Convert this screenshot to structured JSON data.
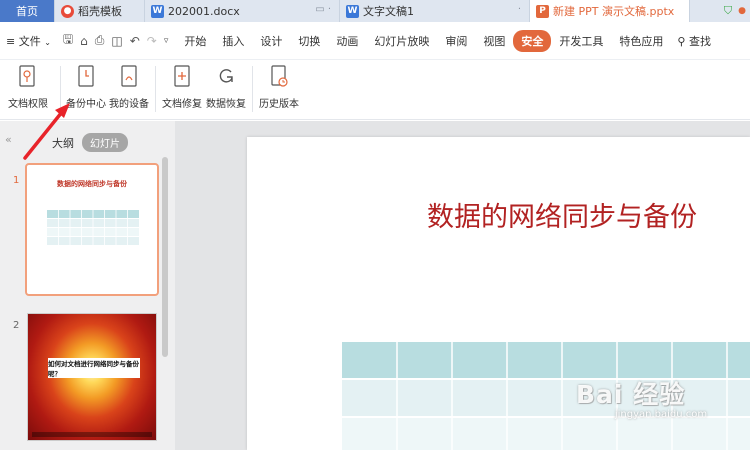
{
  "tabs": [
    {
      "label": "首页",
      "icon": "home-tab"
    },
    {
      "label": "稻壳模板",
      "icon": "docer-icon"
    },
    {
      "label": "202001.docx",
      "icon": "word-doc-icon"
    },
    {
      "label": "文字文稿1",
      "icon": "word-doc-icon"
    },
    {
      "label": "新建 PPT 演示文稿.pptx",
      "icon": "ppt-doc-icon"
    }
  ],
  "menu": {
    "file": "文件",
    "items": [
      "开始",
      "插入",
      "设计",
      "切换",
      "动画",
      "幻灯片放映",
      "审阅",
      "视图",
      "安全",
      "开发工具",
      "特色应用"
    ],
    "active": "安全",
    "search": "查找"
  },
  "ribbon": {
    "buttons": [
      "文档权限",
      "备份中心",
      "我的设备",
      "文档修复",
      "数据恢复",
      "历史版本"
    ]
  },
  "panel": {
    "outline_tab": "大纲",
    "slides_tab": "幻灯片",
    "slide1_num": "1",
    "slide2_num": "2",
    "slide1_title": "数据的网络同步与备份",
    "slide2_title": "如何对文档进行网络同步与备份呢？"
  },
  "slide": {
    "title": "数据的网络同步与备份"
  },
  "watermark": {
    "main": "Bai  经验",
    "sub": "jingyan.baidu.com"
  },
  "colors": {
    "accent": "#e2683c",
    "title_red": "#b22222",
    "table_header": "#b8dde0",
    "table_row": "#e4f1f3"
  }
}
